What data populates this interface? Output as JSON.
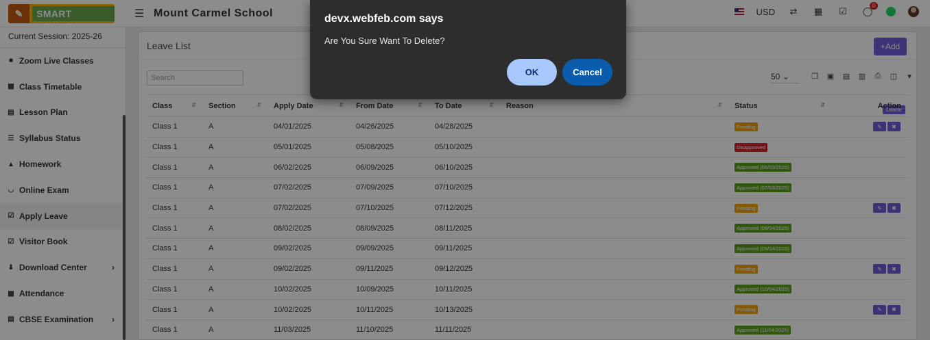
{
  "header": {
    "logo_text": "SMART SCHOOL",
    "school_name": "Mount Carmel School",
    "currency": "USD",
    "notification_count": "0"
  },
  "sidebar": {
    "session": "Current Session: 2025-26",
    "items": [
      {
        "label": "Zoom Live Classes",
        "icon": "video-icon"
      },
      {
        "label": "Class Timetable",
        "icon": "calendar-icon"
      },
      {
        "label": "Lesson Plan",
        "icon": "list-icon"
      },
      {
        "label": "Syllabus Status",
        "icon": "list-icon"
      },
      {
        "label": "Homework",
        "icon": "flask-icon"
      },
      {
        "label": "Online Exam",
        "icon": "rss-icon"
      },
      {
        "label": "Apply Leave",
        "icon": "check-square-icon"
      },
      {
        "label": "Visitor Book",
        "icon": "check-square-icon"
      },
      {
        "label": "Download Center",
        "icon": "download-icon"
      },
      {
        "label": "Attendance",
        "icon": "calendar-icon"
      },
      {
        "label": "CBSE Examination",
        "icon": "list-icon"
      }
    ]
  },
  "main": {
    "title": "Leave List",
    "add_label": "Add",
    "search_placeholder": "Search",
    "page_size": "50",
    "tooltip": "Delete",
    "columns": [
      "Class",
      "Section",
      "Apply Date",
      "From Date",
      "To Date",
      "Reason",
      "Status",
      "Action"
    ],
    "rows": [
      {
        "cls": "Class 1",
        "sec": "A",
        "apply": "04/01/2025",
        "from": "04/26/2025",
        "to": "04/28/2025",
        "status": "Pending",
        "kind": "pending",
        "actions": true
      },
      {
        "cls": "Class 1",
        "sec": "A",
        "apply": "05/01/2025",
        "from": "05/08/2025",
        "to": "05/10/2025",
        "status": "Disapproved",
        "kind": "dis",
        "actions": false
      },
      {
        "cls": "Class 1",
        "sec": "A",
        "apply": "06/02/2025",
        "from": "06/09/2025",
        "to": "06/10/2025",
        "status": "Approved (06/03/2025)",
        "kind": "app",
        "actions": false
      },
      {
        "cls": "Class 1",
        "sec": "A",
        "apply": "07/02/2025",
        "from": "07/09/2025",
        "to": "07/10/2025",
        "status": "Approved (07/03/2025)",
        "kind": "app",
        "actions": false
      },
      {
        "cls": "Class 1",
        "sec": "A",
        "apply": "07/02/2025",
        "from": "07/10/2025",
        "to": "07/12/2025",
        "status": "Pending",
        "kind": "pending",
        "actions": true
      },
      {
        "cls": "Class 1",
        "sec": "A",
        "apply": "08/02/2025",
        "from": "08/09/2025",
        "to": "08/11/2025",
        "status": "Approved (08/04/2025)",
        "kind": "app",
        "actions": false
      },
      {
        "cls": "Class 1",
        "sec": "A",
        "apply": "09/02/2025",
        "from": "09/09/2025",
        "to": "09/11/2025",
        "status": "Approved (09/04/2025)",
        "kind": "app",
        "actions": false
      },
      {
        "cls": "Class 1",
        "sec": "A",
        "apply": "09/02/2025",
        "from": "09/11/2025",
        "to": "09/12/2025",
        "status": "Pending",
        "kind": "pending",
        "actions": true
      },
      {
        "cls": "Class 1",
        "sec": "A",
        "apply": "10/02/2025",
        "from": "10/09/2025",
        "to": "10/11/2025",
        "status": "Approved (10/04/2025)",
        "kind": "app",
        "actions": false
      },
      {
        "cls": "Class 1",
        "sec": "A",
        "apply": "10/02/2025",
        "from": "10/11/2025",
        "to": "10/13/2025",
        "status": "Pending",
        "kind": "pending",
        "actions": true
      },
      {
        "cls": "Class 1",
        "sec": "A",
        "apply": "11/03/2025",
        "from": "11/10/2025",
        "to": "11/11/2025",
        "status": "Approved (11/04/2025)",
        "kind": "app",
        "actions": false
      }
    ]
  },
  "dialog": {
    "title": "devx.webfeb.com says",
    "message": "Are You Sure Want To Delete?",
    "ok_label": "OK",
    "cancel_label": "Cancel"
  }
}
